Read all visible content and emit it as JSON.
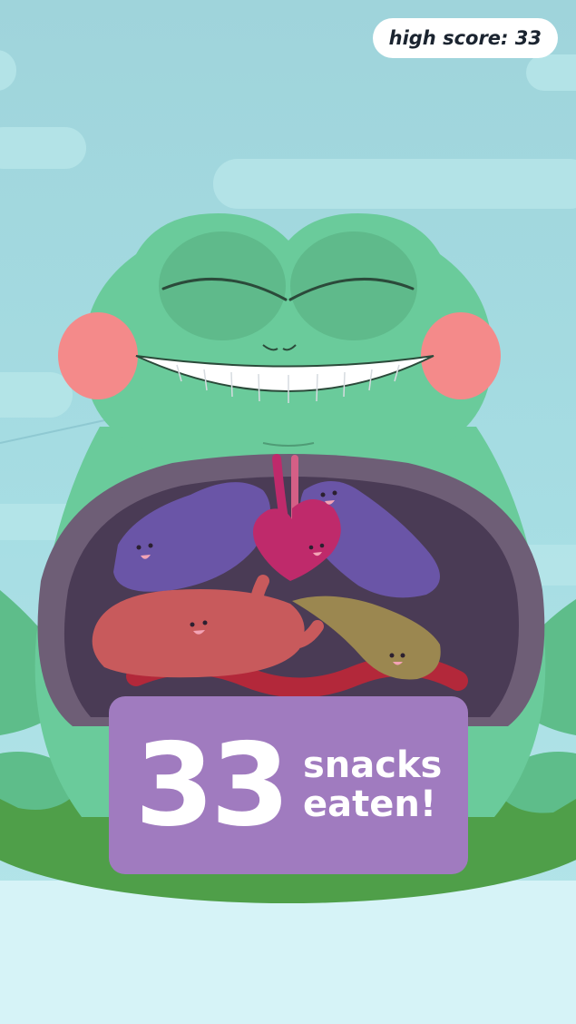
{
  "hud": {
    "high_score_label": "high score:",
    "high_score_value": "33"
  },
  "result": {
    "count": "33",
    "line1": "snacks",
    "line2": "eaten!"
  },
  "colors": {
    "sky": "#a6dbe2",
    "frog_green": "#6ccb9c",
    "frog_dark": "#5fb98a",
    "cheek": "#f48a8a",
    "belly_rim": "#6e5e76",
    "belly_inner": "#4a3b55",
    "organ_purple": "#6a55a7",
    "organ_magenta": "#bf2a6b",
    "organ_red": "#c85a5c",
    "organ_olive": "#9b8750",
    "lily_pad": "#4c9c49",
    "panel": "#a07bbf"
  }
}
